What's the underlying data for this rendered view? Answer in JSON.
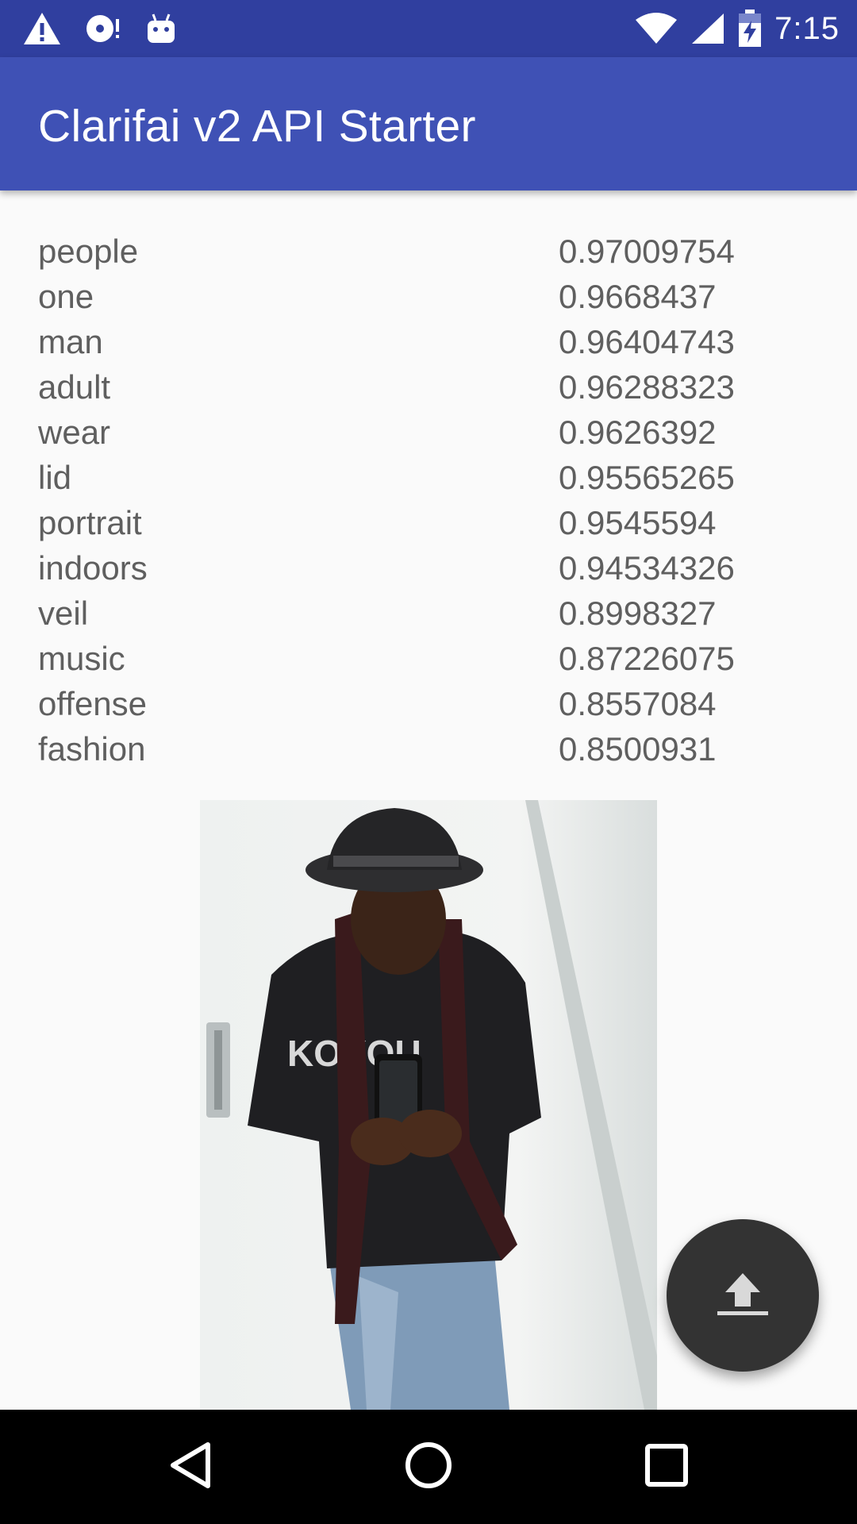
{
  "status_bar": {
    "time": "7:15",
    "icons": [
      "warning-icon",
      "disc-icon",
      "android-icon",
      "wifi-icon",
      "signal-icon",
      "battery-charging-icon"
    ]
  },
  "app_bar": {
    "title": "Clarifai v2 API Starter"
  },
  "tags": [
    {
      "name": "people",
      "value": "0.97009754"
    },
    {
      "name": "one",
      "value": "0.9668437"
    },
    {
      "name": "man",
      "value": "0.96404743"
    },
    {
      "name": "adult",
      "value": "0.96288323"
    },
    {
      "name": "wear",
      "value": "0.9626392"
    },
    {
      "name": "lid",
      "value": "0.95565265"
    },
    {
      "name": "portrait",
      "value": "0.9545594"
    },
    {
      "name": "indoors",
      "value": "0.94534326"
    },
    {
      "name": "veil",
      "value": "0.8998327"
    },
    {
      "name": "music",
      "value": "0.87226075"
    },
    {
      "name": "offense",
      "value": "0.8557084"
    },
    {
      "name": "fashion",
      "value": "0.8500931"
    }
  ],
  "fab": {
    "icon": "upload-icon"
  },
  "nav_bar": {
    "icons": [
      "back-icon",
      "home-icon",
      "recents-icon"
    ]
  },
  "colors": {
    "status_bar": "#303f9f",
    "app_bar": "#3f51b5",
    "fab": "#333333",
    "text": "#5f5f5f"
  }
}
